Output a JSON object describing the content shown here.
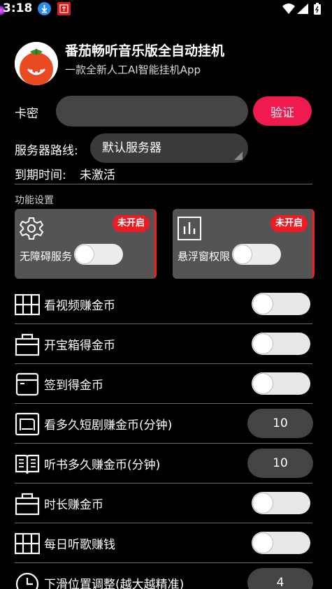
{
  "status_bar": {
    "time": "3:18",
    "icons": [
      "download-icon",
      "app-notification-icon",
      "wifi-icon",
      "signal-icon",
      "battery-icon"
    ]
  },
  "app": {
    "title": "番茄畅听音乐版全自动挂机",
    "subtitle": "一款全新人工AI智能挂机App"
  },
  "auth": {
    "card_label": "卡密",
    "card_value": "",
    "verify_label": "验证",
    "server_label": "服务器路线:",
    "server_value": "默认服务器",
    "expiry_label": "到期时间:",
    "expiry_value": "未激活"
  },
  "function_settings": {
    "section_label": "功能设置",
    "permissions": [
      {
        "name": "无障碍服务",
        "status": "未开启",
        "icon": "gear-icon",
        "enabled": false
      },
      {
        "name": "悬浮窗权限",
        "status": "未开启",
        "icon": "chart-icon",
        "enabled": false
      }
    ]
  },
  "tasks": [
    {
      "label": "看视频赚金币",
      "icon": "grid-icon",
      "control": "toggle",
      "enabled": false
    },
    {
      "label": "开宝箱得金币",
      "icon": "treasure-box-icon",
      "control": "toggle",
      "enabled": false
    },
    {
      "label": "签到得金币",
      "icon": "calendar-icon",
      "control": "toggle",
      "enabled": false
    },
    {
      "label": "看多久短剧赚金币(分钟)",
      "icon": "video-icon",
      "control": "number",
      "value": "10"
    },
    {
      "label": "听书多久赚金币(分钟)",
      "icon": "book-icon",
      "control": "number",
      "value": "10"
    },
    {
      "label": "时长赚金币",
      "icon": "treasure-box-icon",
      "control": "toggle",
      "enabled": false
    },
    {
      "label": "每日听歌赚钱",
      "icon": "grid-icon",
      "control": "toggle",
      "enabled": false
    },
    {
      "label": "下滑位置调整(越大越精准)",
      "icon": "clock-icon",
      "control": "number",
      "value": "4"
    }
  ],
  "colors": {
    "background": "#000000",
    "accent_red": "#ef1a4d",
    "badge_red": "#ee1c22",
    "card_gray": "#545454",
    "pill_gray": "#444444"
  }
}
